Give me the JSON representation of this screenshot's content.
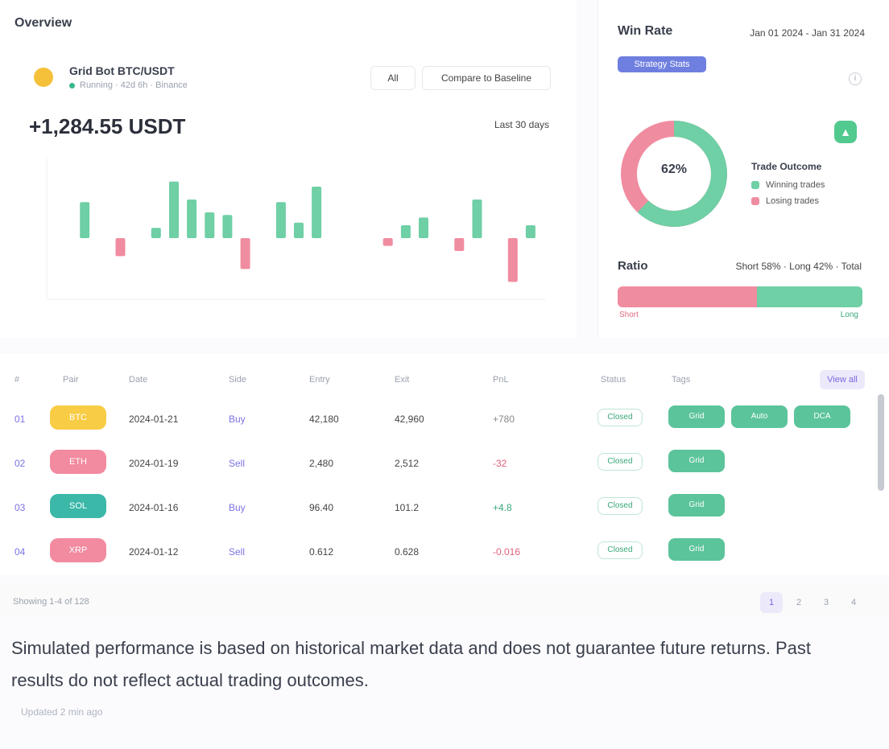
{
  "section_title": "Overview",
  "bot": {
    "name": "Grid Bot BTC/USDT",
    "subtitle": "Running · 42d 6h · Binance",
    "all_button": "All",
    "compare_button": "Compare to Baseline",
    "pnl_value": "+1,284.55 USDT",
    "pnl_period": "Last 30 days"
  },
  "chart_data": {
    "type": "bar",
    "values": [
      0,
      28,
      0,
      -14,
      0,
      8,
      44,
      30,
      20,
      18,
      -24,
      0,
      28,
      12,
      40,
      0,
      0,
      0,
      -6,
      10,
      16,
      0,
      -10,
      30,
      0,
      -34,
      10
    ]
  },
  "right_panel": {
    "title": "Win Rate",
    "range": "Jan 01 2024 - Jan 31 2024",
    "tag": "Strategy Stats",
    "info_icon": "info-icon",
    "donut_label": "62%",
    "donut_pos_fraction": 0.62,
    "up_icon": "arrow-up-icon",
    "legend_title": "Trade Outcome",
    "legend": [
      {
        "label": "Winning trades",
        "color": "#6fcfa5"
      },
      {
        "label": "Losing trades",
        "color": "#f08ca0"
      }
    ],
    "ratio_title": "Ratio",
    "ratio_text": "Short 58% · Long 42% · Total",
    "ratio_neg_fraction": 0.57,
    "ratio_left_label": "Short",
    "ratio_right_label": "Long"
  },
  "table": {
    "headers": [
      "#",
      "Pair",
      "Date",
      "Side",
      "Entry",
      "Exit",
      "PnL",
      "Status",
      "Tags"
    ],
    "view_all": "View all",
    "rows": [
      {
        "idx": "01",
        "pair": "BTC",
        "pair_color": "#f8cc44",
        "date": "2024-01-21",
        "side": "Buy",
        "entry": "42,180",
        "exit": "42,960",
        "pnl": "+780",
        "pnl_color": "#888",
        "status": "Closed",
        "tags": [
          "Grid",
          "Auto",
          "DCA"
        ]
      },
      {
        "idx": "02",
        "pair": "ETH",
        "pair_color": "#f28aa0",
        "date": "2024-01-19",
        "side": "Sell",
        "entry": "2,480",
        "exit": "2,512",
        "pnl": "-32",
        "pnl_color": "#e0607a",
        "status": "Closed",
        "tags": [
          "Grid"
        ]
      },
      {
        "idx": "03",
        "pair": "SOL",
        "pair_color": "#3bb8a8",
        "date": "2024-01-16",
        "side": "Buy",
        "entry": "96.40",
        "exit": "101.2",
        "pnl": "+4.8",
        "pnl_color": "#39a87a",
        "status": "Closed",
        "tags": [
          "Grid"
        ]
      },
      {
        "idx": "04",
        "pair": "XRP",
        "pair_color": "#f28aa0",
        "date": "2024-01-12",
        "side": "Sell",
        "entry": "0.612",
        "exit": "0.628",
        "pnl": "-0.016",
        "pnl_color": "#e0607a",
        "status": "Closed",
        "tags": [
          "Grid"
        ]
      }
    ]
  },
  "pager": {
    "showing": "Showing 1-4 of 128",
    "pages": [
      "1",
      "2",
      "3",
      "4"
    ]
  },
  "disclaimer": "Simulated performance is based on historical market data and does not guarantee future returns. Past results do not reflect actual trading outcomes.",
  "disclaimer_sub": "Updated 2 min ago"
}
